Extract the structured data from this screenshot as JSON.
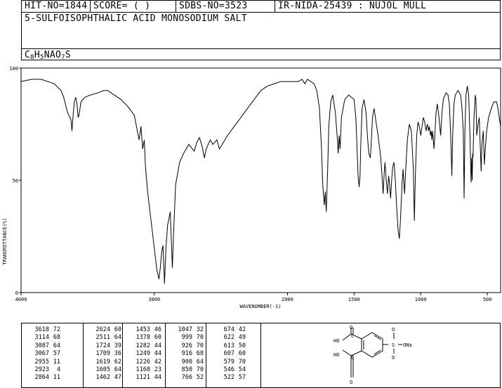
{
  "header": {
    "hit_no": "HIT-NO=1844",
    "score": "SCORE=  (   )",
    "sdbs_no": "SDBS-NO=3523",
    "ir_id": "IR-NIDA-25439 : NUJOL MULL",
    "compound_name": "5-SULFOISOPHTHALIC ACID MONOSODIUM SALT",
    "formula_parts": [
      {
        "t": "C",
        "sub": false
      },
      {
        "t": "8",
        "sub": true
      },
      {
        "t": "H",
        "sub": false
      },
      {
        "t": "5",
        "sub": true
      },
      {
        "t": "NAO",
        "sub": false
      },
      {
        "t": "7",
        "sub": true
      },
      {
        "t": "S",
        "sub": false
      }
    ]
  },
  "chart_data": {
    "type": "line",
    "title": "",
    "xlabel": "WAVENUMBER(-1)",
    "ylabel": "TRANSMITTANCE(%)",
    "xlim": [
      4000,
      400
    ],
    "ylim": [
      0,
      100
    ],
    "x_ticks": [
      4000,
      3000,
      2000,
      1500,
      1000,
      500
    ],
    "y_ticks": [
      0,
      50,
      100
    ],
    "grid": false,
    "series": [
      {
        "points": [
          [
            4000,
            94
          ],
          [
            3920,
            95
          ],
          [
            3850,
            95
          ],
          [
            3800,
            94
          ],
          [
            3750,
            93
          ],
          [
            3700,
            90
          ],
          [
            3680,
            87
          ],
          [
            3650,
            80
          ],
          [
            3625,
            77
          ],
          [
            3618,
            72
          ],
          [
            3608,
            80
          ],
          [
            3600,
            85
          ],
          [
            3590,
            87
          ],
          [
            3580,
            84
          ],
          [
            3572,
            78
          ],
          [
            3565,
            79
          ],
          [
            3550,
            85
          ],
          [
            3520,
            87
          ],
          [
            3480,
            88
          ],
          [
            3420,
            89
          ],
          [
            3380,
            90
          ],
          [
            3350,
            90
          ],
          [
            3300,
            88
          ],
          [
            3250,
            86
          ],
          [
            3200,
            83
          ],
          [
            3150,
            79
          ],
          [
            3114,
            68
          ],
          [
            3100,
            74
          ],
          [
            3087,
            64
          ],
          [
            3075,
            68
          ],
          [
            3067,
            57
          ],
          [
            3050,
            45
          ],
          [
            3020,
            30
          ],
          [
            3000,
            20
          ],
          [
            2980,
            10
          ],
          [
            2965,
            6
          ],
          [
            2955,
            11
          ],
          [
            2945,
            18
          ],
          [
            2935,
            21
          ],
          [
            2923,
            4
          ],
          [
            2912,
            20
          ],
          [
            2900,
            30
          ],
          [
            2880,
            36
          ],
          [
            2864,
            11
          ],
          [
            2855,
            26
          ],
          [
            2840,
            48
          ],
          [
            2810,
            58
          ],
          [
            2780,
            62
          ],
          [
            2740,
            66
          ],
          [
            2700,
            63
          ],
          [
            2680,
            67
          ],
          [
            2660,
            69
          ],
          [
            2640,
            65
          ],
          [
            2624,
            60
          ],
          [
            2610,
            64
          ],
          [
            2580,
            68
          ],
          [
            2560,
            66
          ],
          [
            2530,
            68
          ],
          [
            2511,
            64
          ],
          [
            2490,
            66
          ],
          [
            2450,
            70
          ],
          [
            2400,
            74
          ],
          [
            2350,
            78
          ],
          [
            2300,
            82
          ],
          [
            2250,
            86
          ],
          [
            2200,
            90
          ],
          [
            2150,
            92
          ],
          [
            2100,
            93
          ],
          [
            2050,
            94
          ],
          [
            2000,
            94
          ],
          [
            1950,
            94
          ],
          [
            1920,
            94
          ],
          [
            1890,
            95
          ],
          [
            1870,
            93
          ],
          [
            1850,
            95
          ],
          [
            1800,
            93
          ],
          [
            1780,
            90
          ],
          [
            1760,
            82
          ],
          [
            1745,
            65
          ],
          [
            1735,
            48
          ],
          [
            1724,
            39
          ],
          [
            1716,
            45
          ],
          [
            1709,
            36
          ],
          [
            1698,
            55
          ],
          [
            1690,
            74
          ],
          [
            1675,
            85
          ],
          [
            1660,
            88
          ],
          [
            1640,
            80
          ],
          [
            1625,
            68
          ],
          [
            1619,
            62
          ],
          [
            1612,
            70
          ],
          [
            1605,
            64
          ],
          [
            1595,
            78
          ],
          [
            1570,
            86
          ],
          [
            1540,
            88
          ],
          [
            1520,
            87
          ],
          [
            1500,
            86
          ],
          [
            1487,
            78
          ],
          [
            1480,
            68
          ],
          [
            1470,
            52
          ],
          [
            1462,
            47
          ],
          [
            1455,
            52
          ],
          [
            1450,
            65
          ],
          [
            1440,
            82
          ],
          [
            1425,
            86
          ],
          [
            1410,
            80
          ],
          [
            1400,
            70
          ],
          [
            1390,
            62
          ],
          [
            1378,
            60
          ],
          [
            1370,
            68
          ],
          [
            1362,
            78
          ],
          [
            1350,
            82
          ],
          [
            1335,
            76
          ],
          [
            1320,
            70
          ],
          [
            1300,
            60
          ],
          [
            1290,
            52
          ],
          [
            1282,
            44
          ],
          [
            1275,
            52
          ],
          [
            1268,
            58
          ],
          [
            1258,
            50
          ],
          [
            1249,
            44
          ],
          [
            1240,
            52
          ],
          [
            1233,
            48
          ],
          [
            1226,
            42
          ],
          [
            1218,
            50
          ],
          [
            1210,
            56
          ],
          [
            1200,
            58
          ],
          [
            1190,
            50
          ],
          [
            1180,
            38
          ],
          [
            1170,
            28
          ],
          [
            1160,
            24
          ],
          [
            1152,
            32
          ],
          [
            1140,
            48
          ],
          [
            1132,
            55
          ],
          [
            1121,
            44
          ],
          [
            1112,
            55
          ],
          [
            1100,
            68
          ],
          [
            1085,
            75
          ],
          [
            1070,
            72
          ],
          [
            1055,
            55
          ],
          [
            1047,
            32
          ],
          [
            1040,
            52
          ],
          [
            1030,
            70
          ],
          [
            1020,
            76
          ],
          [
            1010,
            74
          ],
          [
            999,
            70
          ],
          [
            990,
            74
          ],
          [
            980,
            78
          ],
          [
            970,
            76
          ],
          [
            960,
            72
          ],
          [
            950,
            75
          ],
          [
            940,
            72
          ],
          [
            935,
            74
          ],
          [
            926,
            70
          ],
          [
            921,
            72
          ],
          [
            916,
            68
          ],
          [
            910,
            72
          ],
          [
            900,
            64
          ],
          [
            892,
            72
          ],
          [
            885,
            80
          ],
          [
            875,
            84
          ],
          [
            862,
            78
          ],
          [
            850,
            70
          ],
          [
            840,
            80
          ],
          [
            830,
            86
          ],
          [
            810,
            89
          ],
          [
            795,
            88
          ],
          [
            785,
            84
          ],
          [
            775,
            70
          ],
          [
            766,
            52
          ],
          [
            760,
            70
          ],
          [
            750,
            84
          ],
          [
            740,
            88
          ],
          [
            720,
            90
          ],
          [
            700,
            88
          ],
          [
            690,
            82
          ],
          [
            680,
            72
          ],
          [
            674,
            42
          ],
          [
            668,
            72
          ],
          [
            660,
            88
          ],
          [
            650,
            92
          ],
          [
            640,
            88
          ],
          [
            630,
            70
          ],
          [
            622,
            49
          ],
          [
            617,
            60
          ],
          [
            613,
            50
          ],
          [
            610,
            62
          ],
          [
            607,
            60
          ],
          [
            600,
            78
          ],
          [
            590,
            88
          ],
          [
            585,
            86
          ],
          [
            579,
            70
          ],
          [
            572,
            74
          ],
          [
            560,
            78
          ],
          [
            546,
            54
          ],
          [
            540,
            66
          ],
          [
            530,
            72
          ],
          [
            522,
            57
          ],
          [
            515,
            64
          ],
          [
            505,
            72
          ],
          [
            490,
            78
          ],
          [
            470,
            82
          ],
          [
            450,
            85
          ],
          [
            430,
            85
          ],
          [
            420,
            82
          ],
          [
            410,
            78
          ],
          [
            400,
            74
          ]
        ]
      }
    ]
  },
  "peak_table": {
    "columns": [
      [
        [
          "3618",
          "72"
        ],
        [
          "3114",
          "68"
        ],
        [
          "3087",
          "64"
        ],
        [
          "3067",
          "57"
        ],
        [
          "2955",
          "11"
        ],
        [
          "2923",
          "4"
        ],
        [
          "2864",
          "11"
        ]
      ],
      [
        [
          "2624",
          "60"
        ],
        [
          "2511",
          "64"
        ],
        [
          "1724",
          "39"
        ],
        [
          "1709",
          "36"
        ],
        [
          "1619",
          "62"
        ],
        [
          "1605",
          "64"
        ],
        [
          "1462",
          "47"
        ]
      ],
      [
        [
          "1453",
          "46"
        ],
        [
          "1378",
          "60"
        ],
        [
          "1282",
          "44"
        ],
        [
          "1249",
          "44"
        ],
        [
          "1226",
          "42"
        ],
        [
          "1168",
          "23"
        ],
        [
          "1121",
          "44"
        ]
      ],
      [
        [
          "1047",
          "32"
        ],
        [
          "999",
          "70"
        ],
        [
          "926",
          "70"
        ],
        [
          "916",
          "68"
        ],
        [
          "900",
          "64"
        ],
        [
          "850",
          "70"
        ],
        [
          "766",
          "52"
        ]
      ],
      [
        [
          "674",
          "42"
        ],
        [
          "622",
          "49"
        ],
        [
          "613",
          "50"
        ],
        [
          "607",
          "60"
        ],
        [
          "579",
          "70"
        ],
        [
          "546",
          "54"
        ],
        [
          "522",
          "57"
        ]
      ]
    ]
  },
  "structure": {
    "labels": {
      "top_o": "O",
      "top_c": "C",
      "top_ho": "HO",
      "bot_c": "C",
      "bot_ho": "HO",
      "bot_o": "O",
      "s": "S",
      "s_o_top": "O",
      "s_o_bot": "O",
      "s_ona": "ONa"
    }
  }
}
